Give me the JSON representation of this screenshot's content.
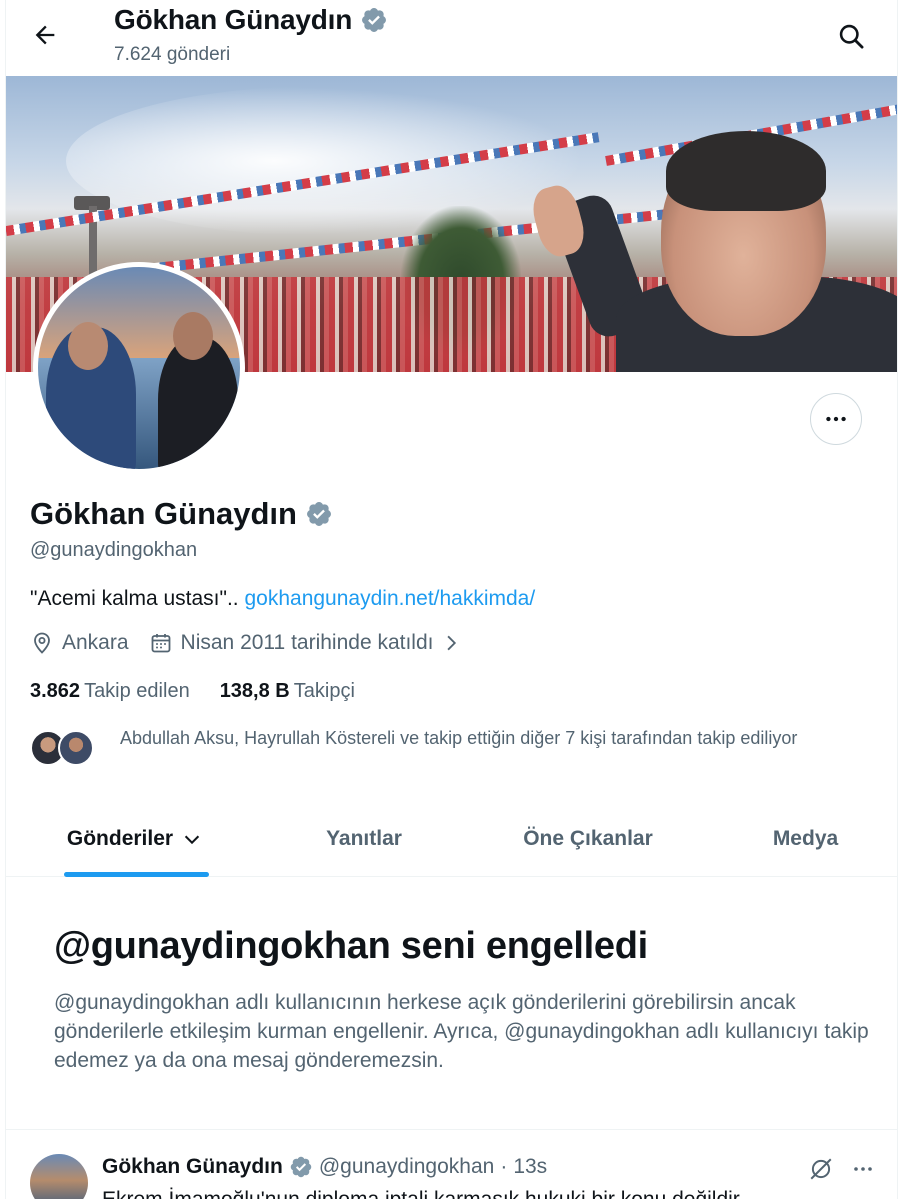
{
  "header": {
    "title": "Gökhan Günaydın",
    "post_count": "7.624 gönderi"
  },
  "profile": {
    "name": "Gökhan Günaydın",
    "handle": "@gunaydingokhan",
    "bio_text": "\"Acemi kalma ustası\"..",
    "bio_link": "gokhangunaydin.net/hakkimda/",
    "location": "Ankara",
    "joined": "Nisan 2011 tarihinde katıldı",
    "following_count": "3.862",
    "following_label": "Takip edilen",
    "followers_count": "138,8 B",
    "followers_label": "Takipçi",
    "followed_by": "Abdullah Aksu, Hayrullah Köstereli ve takip ettiğin diğer 7 kişi tarafından takip ediliyor"
  },
  "tabs": [
    {
      "label": "Gönderiler",
      "active": true
    },
    {
      "label": "Yanıtlar",
      "active": false
    },
    {
      "label": "Öne Çıkanlar",
      "active": false
    },
    {
      "label": "Medya",
      "active": false
    }
  ],
  "blocked": {
    "title": "@gunaydingokhan seni engelledi",
    "description": "@gunaydingokhan adlı kullanıcının herkese açık gönderilerini görebilirsin ancak gönderilerle etkileşim kurman engellenir. Ayrıca, @gunaydingokhan adlı kullanıcıyı takip edemez ya da ona mesaj gönderemezsin."
  },
  "tweet": {
    "name": "Gökhan Günaydın",
    "handle": "@gunaydingokhan",
    "separator": "·",
    "time": "13s",
    "text": "Ekrem İmamoğlu'nun diploma iptali karmaşık hukuki bir konu değildir"
  },
  "icons": {
    "back": "arrow-left-icon",
    "search": "search-icon",
    "verified": "verified-badge-icon",
    "more": "more-horizontal-icon",
    "location": "location-pin-icon",
    "calendar": "calendar-icon",
    "chevron": "chevron-right-icon",
    "dropdown": "chevron-down-icon",
    "grok": "grok-icon"
  },
  "colors": {
    "accent": "#1d9bf0",
    "text_primary": "#0f1419",
    "text_secondary": "#536471",
    "verified_badge": "#829aab"
  }
}
